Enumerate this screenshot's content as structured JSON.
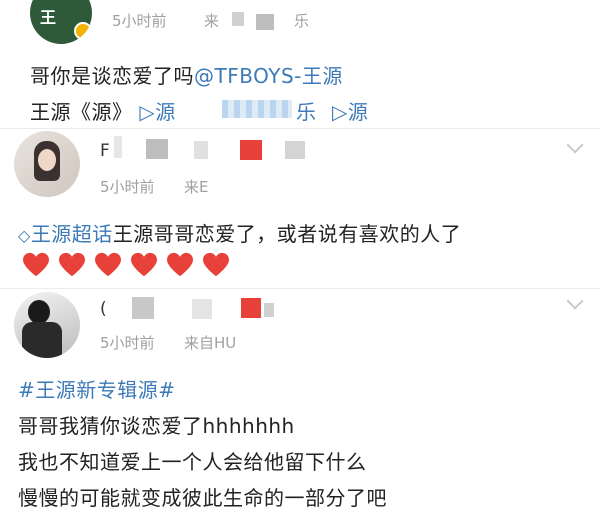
{
  "post1": {
    "meta_time": "5小时前",
    "meta_source": "来",
    "meta_trail": "乐",
    "line1": "哥你是谈恋爱了吗",
    "mention": "@TFBOYS-王源",
    "line2_prefix": "王源《源》",
    "link1": "▷源",
    "link2_tail": "乐",
    "link3": "▷源"
  },
  "comment1": {
    "name_initial": "F",
    "meta_time": "5小时前",
    "meta_source": "来E",
    "topic": "王源超话",
    "text": "王源哥哥恋爱了，或者说有喜欢的人了",
    "hearts": [
      "❤",
      "❤",
      "❤",
      "❤",
      "❤",
      "❤"
    ]
  },
  "comment2": {
    "name_initial": "(",
    "meta_time": "5小时前",
    "meta_source": "来自HU",
    "hashtag": "#王源新专辑源#",
    "line1": "哥哥我猜你谈恋爱了hhhhhhh",
    "line2": "我也不知道爱上一个人会给他留下什么",
    "line3": "慢慢的可能就变成彼此生命的一部分了吧"
  },
  "colors": {
    "link": "#3d7ab8",
    "meta": "#a0a0a0",
    "heart": "#e8413a",
    "mosaic_red": "#e8413a",
    "mosaic_gray": "#bdbdbd"
  }
}
